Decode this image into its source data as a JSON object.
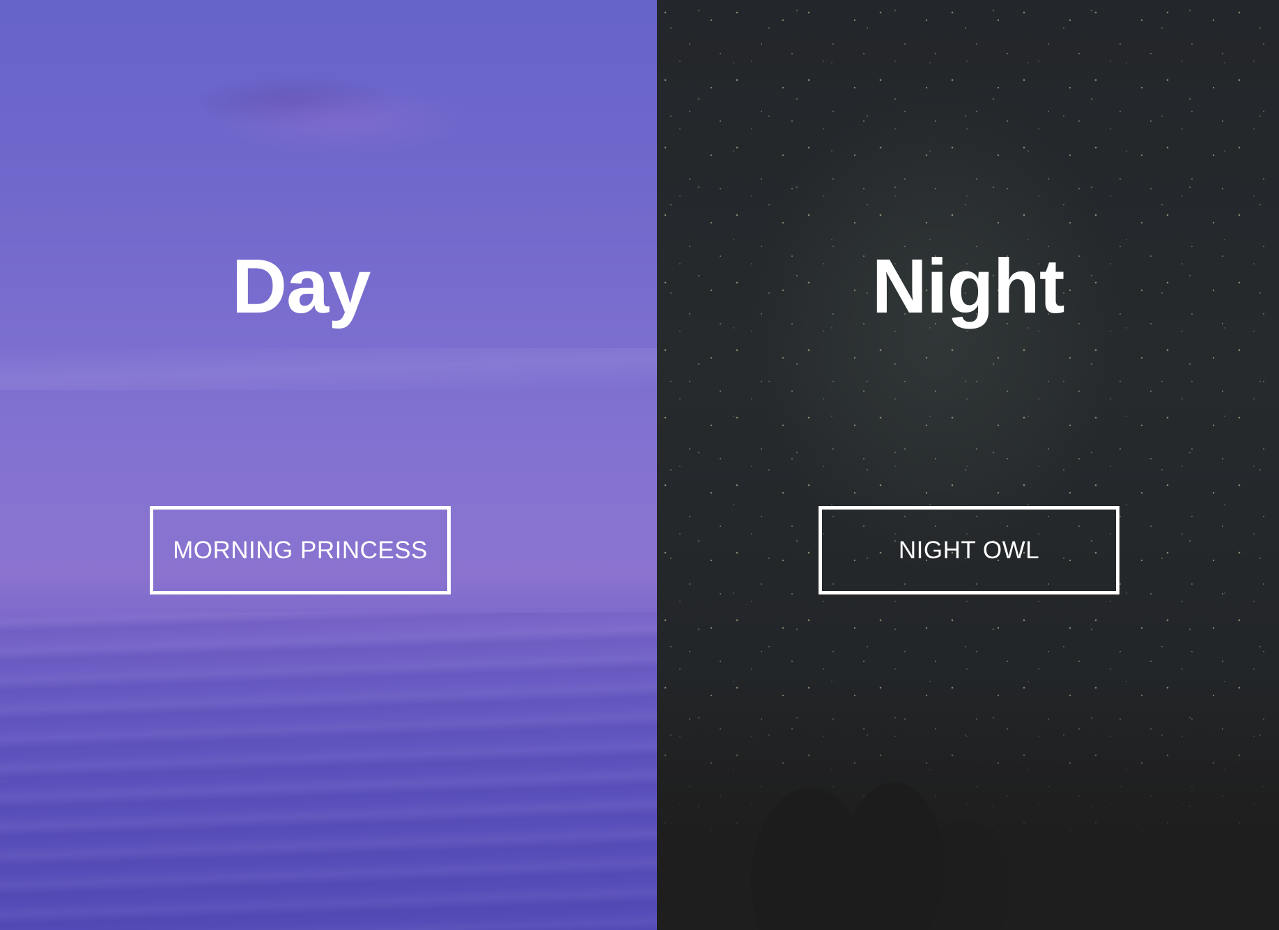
{
  "day": {
    "title": "Day",
    "button_label": "MORNING PRINCESS"
  },
  "night": {
    "title": "Night",
    "button_label": "NIGHT OWL"
  },
  "colors": {
    "day_overlay": "#6f66cc",
    "night_overlay": "#24272a",
    "text": "#ffffff",
    "button_border": "#ffffff"
  }
}
